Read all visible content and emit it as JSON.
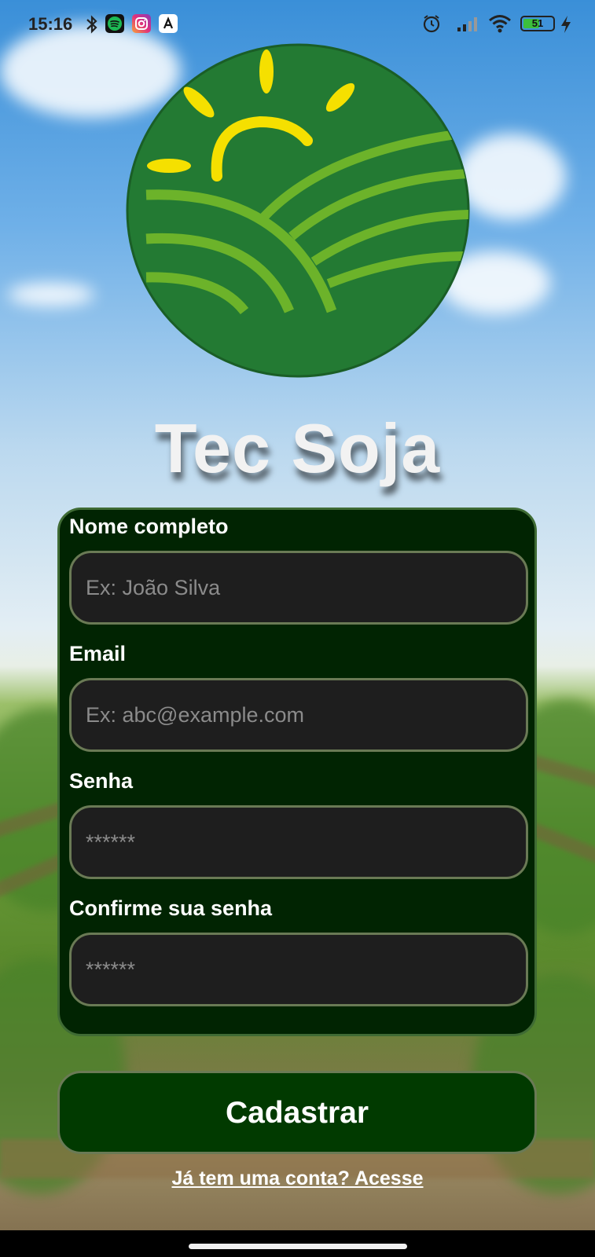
{
  "status_bar": {
    "time": "15:16",
    "left_icons": [
      "bluetooth-icon",
      "spotify-icon",
      "instagram-icon",
      "app-icon"
    ],
    "right_icons": [
      "alarm-icon",
      "signal-icon",
      "wifi-icon",
      "battery-icon",
      "charging-icon"
    ],
    "battery_level": "51"
  },
  "app": {
    "title": "Tec Soja",
    "logo_colors": {
      "circle": "#237a33",
      "sun": "#f5e000",
      "fields": "#6cb32a"
    }
  },
  "form": {
    "fields": [
      {
        "label": "Nome completo",
        "placeholder": "Ex: João Silva",
        "value": ""
      },
      {
        "label": "Email",
        "placeholder": "Ex: abc@example.com",
        "value": ""
      },
      {
        "label": "Senha",
        "placeholder": "******",
        "value": ""
      },
      {
        "label": "Confirme sua senha",
        "placeholder": "******",
        "value": ""
      }
    ],
    "submit_label": "Cadastrar",
    "login_link": "Já tem uma conta? Acesse"
  },
  "colors": {
    "card_bg": "#012402",
    "card_border": "#3f6b34",
    "input_bg": "#1e1e1e",
    "button_bg": "#013a00"
  }
}
